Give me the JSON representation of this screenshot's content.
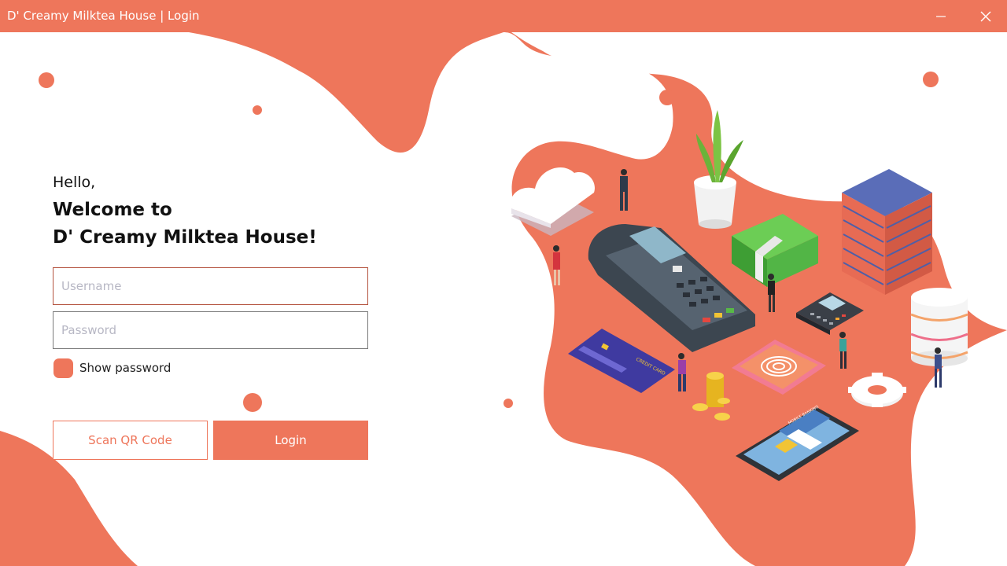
{
  "window": {
    "title": "D' Creamy Milktea House | Login",
    "controls": {
      "minimize_icon": "minimize-icon",
      "close_icon": "close-icon"
    }
  },
  "login": {
    "greeting": "Hello,",
    "welcome_line1": "Welcome to",
    "welcome_line2": "D' Creamy Milktea House!",
    "username_placeholder": "Username",
    "username_value": "",
    "password_placeholder": "Password",
    "password_value": "",
    "show_password_label": "Show password",
    "show_password_checked": false,
    "scan_qr_label": "Scan QR Code",
    "login_label": "Login"
  },
  "illustration": {
    "card_text": "CREDIT CARD",
    "phone_header": "MOBILE BANKING"
  },
  "colors": {
    "accent": "#ee765b",
    "accent_dark": "#b4533f",
    "background": "#ffffff"
  }
}
